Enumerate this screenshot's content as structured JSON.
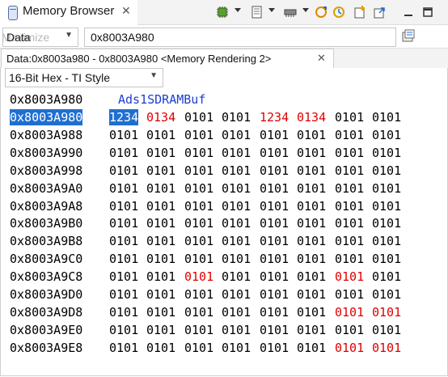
{
  "view": {
    "title": "Memory Browser",
    "close": "✕"
  },
  "toolbar": {
    "icons": [
      "chip-icon",
      "card-icon",
      "memory-icon",
      "sync-icon",
      "refresh-icon",
      "new-tab-icon",
      "export-icon",
      "minimize-icon",
      "maximize-icon"
    ]
  },
  "selector": {
    "value": "Data",
    "ghost_text": "Maximize"
  },
  "address": {
    "value": "0x8003A980"
  },
  "rendering_tab": {
    "title": "Data:0x8003a980 - 0x8003A980 <Memory Rendering 2>",
    "close": "✕"
  },
  "format": {
    "value": "16-Bit Hex - TI Style"
  },
  "colors": {
    "highlight": "#1f6fd1",
    "changed": "#e00000",
    "label": "#1f3fd0"
  },
  "label_row": {
    "address": "0x8003A980",
    "label": "Ads1SDRAMBuf"
  },
  "rows": [
    {
      "address": "0x8003A980",
      "values": [
        "1234",
        "0134",
        "0101",
        "0101",
        "1234",
        "0134",
        "0101",
        "0101"
      ],
      "changed": [
        0,
        1,
        4,
        5
      ],
      "selected": true
    },
    {
      "address": "0x8003A988",
      "values": [
        "0101",
        "0101",
        "0101",
        "0101",
        "0101",
        "0101",
        "0101",
        "0101"
      ],
      "changed": []
    },
    {
      "address": "0x8003A990",
      "values": [
        "0101",
        "0101",
        "0101",
        "0101",
        "0101",
        "0101",
        "0101",
        "0101"
      ],
      "changed": []
    },
    {
      "address": "0x8003A998",
      "values": [
        "0101",
        "0101",
        "0101",
        "0101",
        "0101",
        "0101",
        "0101",
        "0101"
      ],
      "changed": []
    },
    {
      "address": "0x8003A9A0",
      "values": [
        "0101",
        "0101",
        "0101",
        "0101",
        "0101",
        "0101",
        "0101",
        "0101"
      ],
      "changed": []
    },
    {
      "address": "0x8003A9A8",
      "values": [
        "0101",
        "0101",
        "0101",
        "0101",
        "0101",
        "0101",
        "0101",
        "0101"
      ],
      "changed": []
    },
    {
      "address": "0x8003A9B0",
      "values": [
        "0101",
        "0101",
        "0101",
        "0101",
        "0101",
        "0101",
        "0101",
        "0101"
      ],
      "changed": []
    },
    {
      "address": "0x8003A9B8",
      "values": [
        "0101",
        "0101",
        "0101",
        "0101",
        "0101",
        "0101",
        "0101",
        "0101"
      ],
      "changed": []
    },
    {
      "address": "0x8003A9C0",
      "values": [
        "0101",
        "0101",
        "0101",
        "0101",
        "0101",
        "0101",
        "0101",
        "0101"
      ],
      "changed": []
    },
    {
      "address": "0x8003A9C8",
      "values": [
        "0101",
        "0101",
        "0101",
        "0101",
        "0101",
        "0101",
        "0101",
        "0101"
      ],
      "changed": [
        2,
        6
      ]
    },
    {
      "address": "0x8003A9D0",
      "values": [
        "0101",
        "0101",
        "0101",
        "0101",
        "0101",
        "0101",
        "0101",
        "0101"
      ],
      "changed": []
    },
    {
      "address": "0x8003A9D8",
      "values": [
        "0101",
        "0101",
        "0101",
        "0101",
        "0101",
        "0101",
        "0101",
        "0101"
      ],
      "changed": [
        6,
        7
      ]
    },
    {
      "address": "0x8003A9E0",
      "values": [
        "0101",
        "0101",
        "0101",
        "0101",
        "0101",
        "0101",
        "0101",
        "0101"
      ],
      "changed": []
    },
    {
      "address": "0x8003A9E8",
      "values": [
        "0101",
        "0101",
        "0101",
        "0101",
        "0101",
        "0101",
        "0101",
        "0101"
      ],
      "changed": [
        6,
        7
      ]
    }
  ]
}
